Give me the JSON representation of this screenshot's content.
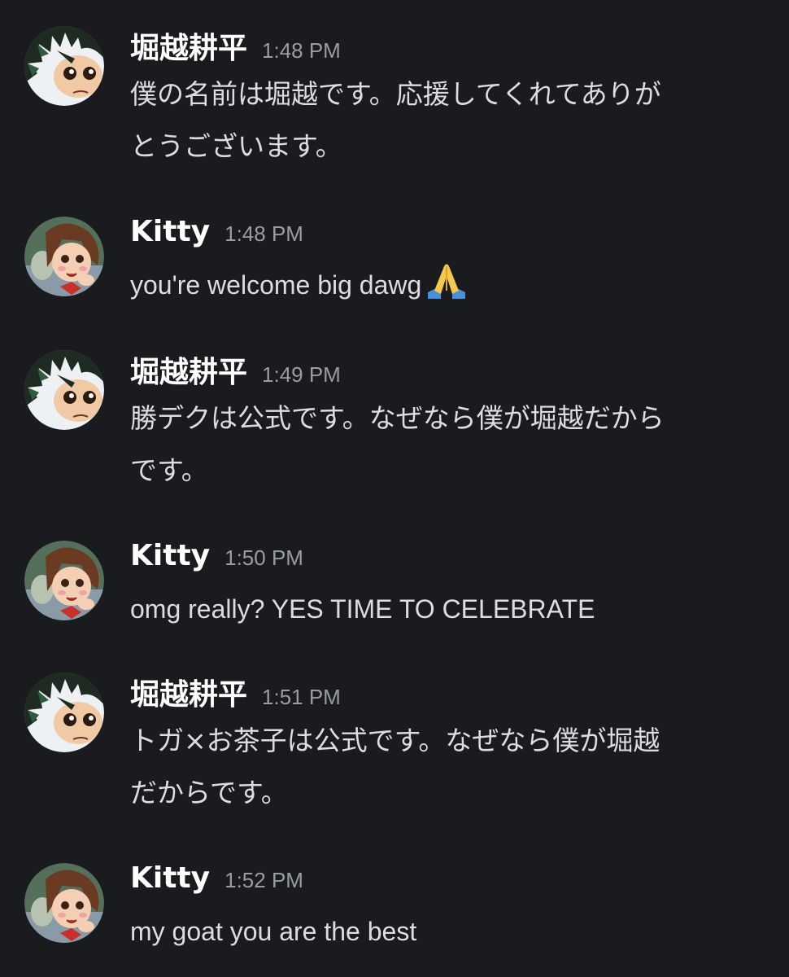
{
  "users": {
    "horikoshi": {
      "name": "堀越耕平",
      "avatar_icon": "deku-avatar-icon"
    },
    "kitty": {
      "name": "Kitty",
      "avatar_icon": "uraraka-avatar-icon"
    }
  },
  "messages": [
    {
      "author": "堀越耕平",
      "time": "1:48 PM",
      "lines": [
        "僕の名前は堀越です。応援してくれてありが",
        "とうございます。"
      ]
    },
    {
      "author": "Kitty",
      "time": "1:48 PM",
      "text": "you're welcome big dawg",
      "emoji": "folded-hands-icon"
    },
    {
      "author": "堀越耕平",
      "time": "1:49 PM",
      "lines": [
        "勝デクは公式です。なぜなら僕が堀越だから",
        "です。"
      ]
    },
    {
      "author": "Kitty",
      "time": "1:50 PM",
      "text": "omg really? YES TIME TO CELEBRATE"
    },
    {
      "author": "堀越耕平",
      "time": "1:51 PM",
      "lines": [
        "トガ×お茶子は公式です。なぜなら僕が堀越",
        "だからです。"
      ]
    },
    {
      "author": "Kitty",
      "time": "1:52 PM",
      "text": "my goat you are the best"
    }
  ],
  "colors": {
    "background": "#1a1b1f",
    "username": "#ffffff",
    "timestamp": "#9a9ca4",
    "message_text": "#dcdde1"
  }
}
